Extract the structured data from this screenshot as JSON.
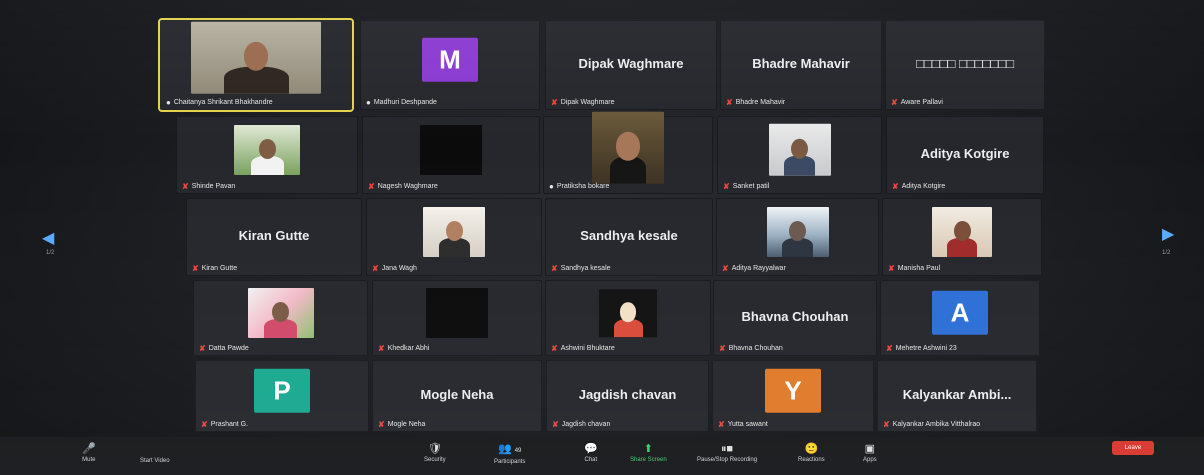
{
  "participants": [
    {
      "tile_name": "",
      "label": "Chaitanya Shrikant Bhakhandre",
      "muted": false,
      "video": "person",
      "active": true
    },
    {
      "tile_name": "",
      "label": "Madhuri Deshpande",
      "muted": false,
      "avatar_letter": "M",
      "avatar_color": "#8a3bd1"
    },
    {
      "tile_name": "Dipak Waghmare",
      "label": "Dipak Waghmare",
      "muted": true
    },
    {
      "tile_name": "Bhadre Mahavir",
      "label": "Bhadre Mahavir",
      "muted": true
    },
    {
      "tile_name": "□□□□□ □□□□□□□",
      "label": "Aware Pallavi",
      "muted": true
    },
    {
      "tile_name": "",
      "label": "Shinde Pavan",
      "muted": true,
      "video": "photo-green"
    },
    {
      "tile_name": "",
      "label": "Nagesh Waghmare",
      "muted": true,
      "video": "dark"
    },
    {
      "tile_name": "",
      "label": "Pratiksha bokare",
      "muted": false,
      "video": "person-woman"
    },
    {
      "tile_name": "",
      "label": "Sanket patil",
      "muted": true,
      "video": "photo-man"
    },
    {
      "tile_name": "Aditya Kotgire",
      "label": "Aditya Kotgire",
      "muted": true
    },
    {
      "tile_name": "Kiran Gutte",
      "label": "Kiran Gutte",
      "muted": true
    },
    {
      "tile_name": "",
      "label": "Jana Wagh",
      "muted": true,
      "video": "photo-woman"
    },
    {
      "tile_name": "Sandhya kesale",
      "label": "Sandhya kesale",
      "muted": true
    },
    {
      "tile_name": "",
      "label": "Aditya Rayyalwar",
      "muted": true,
      "video": "photo-sea"
    },
    {
      "tile_name": "",
      "label": "Manisha Paul",
      "muted": true,
      "video": "photo-woman2"
    },
    {
      "tile_name": "",
      "label": "Datta Pawde",
      "muted": true,
      "video": "photo-flowers"
    },
    {
      "tile_name": "",
      "label": "Khedkar Abhi",
      "muted": true,
      "video": "dark"
    },
    {
      "tile_name": "",
      "label": "Ashwini Bhuktare",
      "muted": true,
      "video": "cartoon"
    },
    {
      "tile_name": "Bhavna Chouhan",
      "label": "Bhavna Chouhan",
      "muted": true
    },
    {
      "tile_name": "",
      "label": "Mehetre Ashwini 23",
      "muted": true,
      "avatar_letter": "A",
      "avatar_color": "#2d6fd6"
    },
    {
      "tile_name": "",
      "label": "Prashant G.",
      "muted": true,
      "avatar_letter": "P",
      "avatar_color": "#1aa890"
    },
    {
      "tile_name": "Mogle Neha",
      "label": "Mogle Neha",
      "muted": true
    },
    {
      "tile_name": "Jagdish chavan",
      "label": "Jagdish chavan",
      "muted": true
    },
    {
      "tile_name": "",
      "label": "Yutta sawant",
      "muted": true,
      "avatar_letter": "Y",
      "avatar_color": "#e07a2a"
    },
    {
      "tile_name": "Kalyankar Ambi...",
      "label": "Kalyankar Ambika Vitthalrao",
      "muted": true
    }
  ],
  "nav": {
    "left_arrow": "◀",
    "right_arrow": "▶",
    "left_page": "1/2",
    "right_page": "1/2"
  },
  "toolbar": {
    "mute": "Mute",
    "start_video": "Start Video",
    "security": "Security",
    "participants": "Participants",
    "participants_count": "49",
    "chat": "Chat",
    "share_screen": "Share Screen",
    "pause_recording": "Pause/Stop Recording",
    "reactions": "Reactions",
    "apps": "Apps",
    "leave": "Leave"
  },
  "icons": {
    "mic": "🎤",
    "video": "🎥",
    "security": "🛡",
    "participants": "👥",
    "chat": "💬",
    "share": "⬆",
    "record": "⏸■",
    "reactions": "🙂",
    "apps": "▣"
  }
}
